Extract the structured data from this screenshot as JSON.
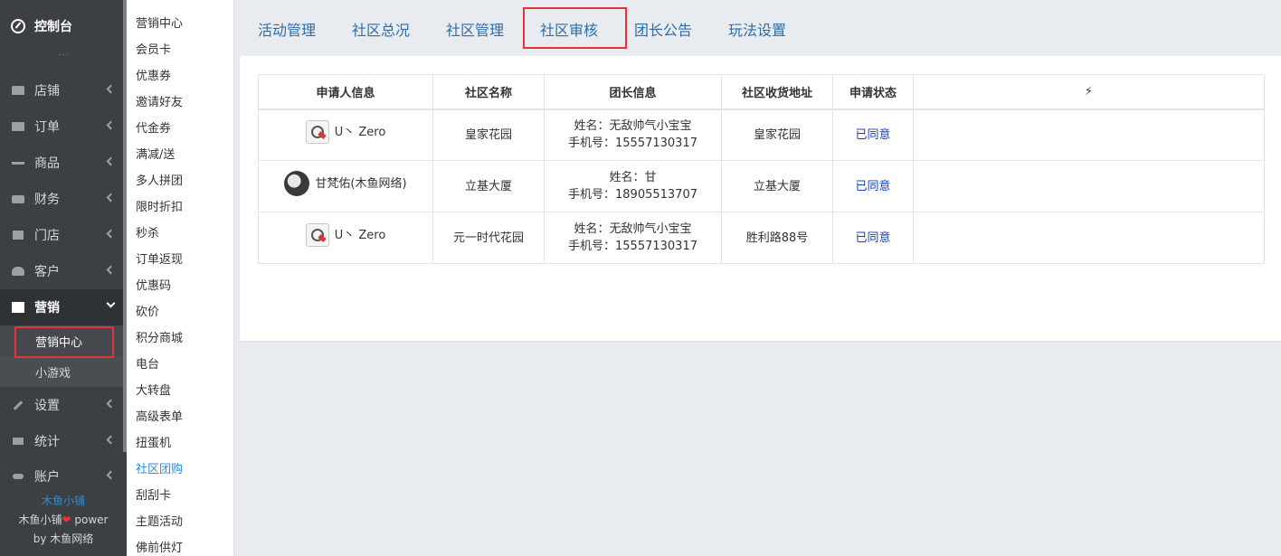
{
  "sidebar": {
    "brand": "控制台",
    "items": [
      {
        "label": "店铺",
        "icon": "shop-icon"
      },
      {
        "label": "订单",
        "icon": "order-icon"
      },
      {
        "label": "商品",
        "icon": "scale-icon"
      },
      {
        "label": "财务",
        "icon": "money-icon"
      },
      {
        "label": "门店",
        "icon": "sitemap-icon"
      },
      {
        "label": "客户",
        "icon": "users-icon"
      },
      {
        "label": "营销",
        "icon": "gift-icon"
      },
      {
        "label": "设置",
        "icon": "wrench-icon"
      },
      {
        "label": "统计",
        "icon": "bar-signal-icon"
      },
      {
        "label": "账户",
        "icon": "key-icon"
      }
    ],
    "submenu": [
      "营销中心",
      "小游戏"
    ],
    "footer": {
      "shop": "木鱼小铺",
      "line2a": "木鱼小铺",
      "line2b": " power",
      "line3": "by 木鱼网络"
    }
  },
  "subnav": [
    "营销中心",
    "会员卡",
    "优惠券",
    "邀请好友",
    "代金券",
    "满减/送",
    "多人拼团",
    "限时折扣",
    "秒杀",
    "订单返现",
    "优惠码",
    "砍价",
    "积分商城",
    "电台",
    "大转盘",
    "高级表单",
    "扭蛋机",
    "社区团购",
    "刮刮卡",
    "主题活动",
    "佛前供灯"
  ],
  "tabs": [
    "活动管理",
    "社区总况",
    "社区管理",
    "社区审核",
    "团长公告",
    "玩法设置"
  ],
  "table": {
    "headers": [
      "申请人信息",
      "社区名称",
      "团长信息",
      "社区收货地址",
      "申请状态",
      "⚡"
    ],
    "rows": [
      {
        "applicant": "U丶 Zero",
        "community": "皇家花园",
        "leader_name": "姓名：无敌帅气小宝宝",
        "leader_phone": "手机号：15557130317",
        "address": "皇家花园",
        "status": "已同意"
      },
      {
        "applicant": "甘梵佑(木鱼网络)",
        "community": "立基大厦",
        "leader_name": "姓名：甘",
        "leader_phone": "手机号：18905513707",
        "address": "立基大厦",
        "status": "已同意"
      },
      {
        "applicant": "U丶 Zero",
        "community": "元一时代花园",
        "leader_name": "姓名：无敌帅气小宝宝",
        "leader_phone": "手机号：15557130317",
        "address": "胜利路88号",
        "status": "已同意"
      }
    ]
  }
}
